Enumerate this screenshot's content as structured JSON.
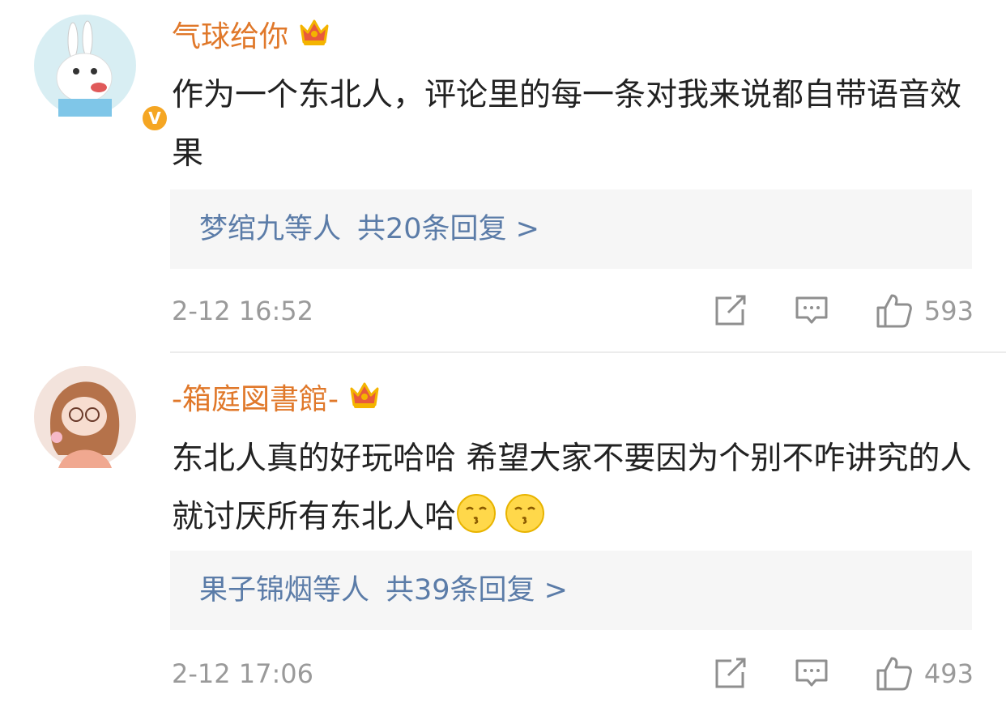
{
  "comments": [
    {
      "username": "气球给你",
      "text": "作为一个东北人，评论里的每一条对我来说都自带语音效果",
      "replies": {
        "names": "梦绾九等人",
        "summary": "共20条回复 >"
      },
      "time": "2-12 16:52",
      "likes": "593",
      "verified": true,
      "icons": [
        "crown-badge-icon",
        "share-icon",
        "comment-icon",
        "like-icon"
      ]
    },
    {
      "username": "-箱庭図書館-",
      "text": "东北人真的好玩哈哈 希望大家不要因为个别不咋讲究的人就讨厌所有东北人哈",
      "emojis": [
        "kiss-emoji-icon",
        "kiss-emoji-icon"
      ],
      "replies": {
        "names": "果子锦烟等人",
        "summary": "共39条回复 >"
      },
      "time": "2-12 17:06",
      "likes": "493",
      "verified": false,
      "icons": [
        "crown-badge-icon",
        "share-icon",
        "comment-icon",
        "like-icon"
      ]
    }
  ],
  "colors": {
    "username": "#e0782a",
    "reply_link": "#5b7ca8",
    "meta": "#9a9a9a",
    "reply_bg": "#f6f6f6",
    "verified_badge": "#f5a623"
  }
}
